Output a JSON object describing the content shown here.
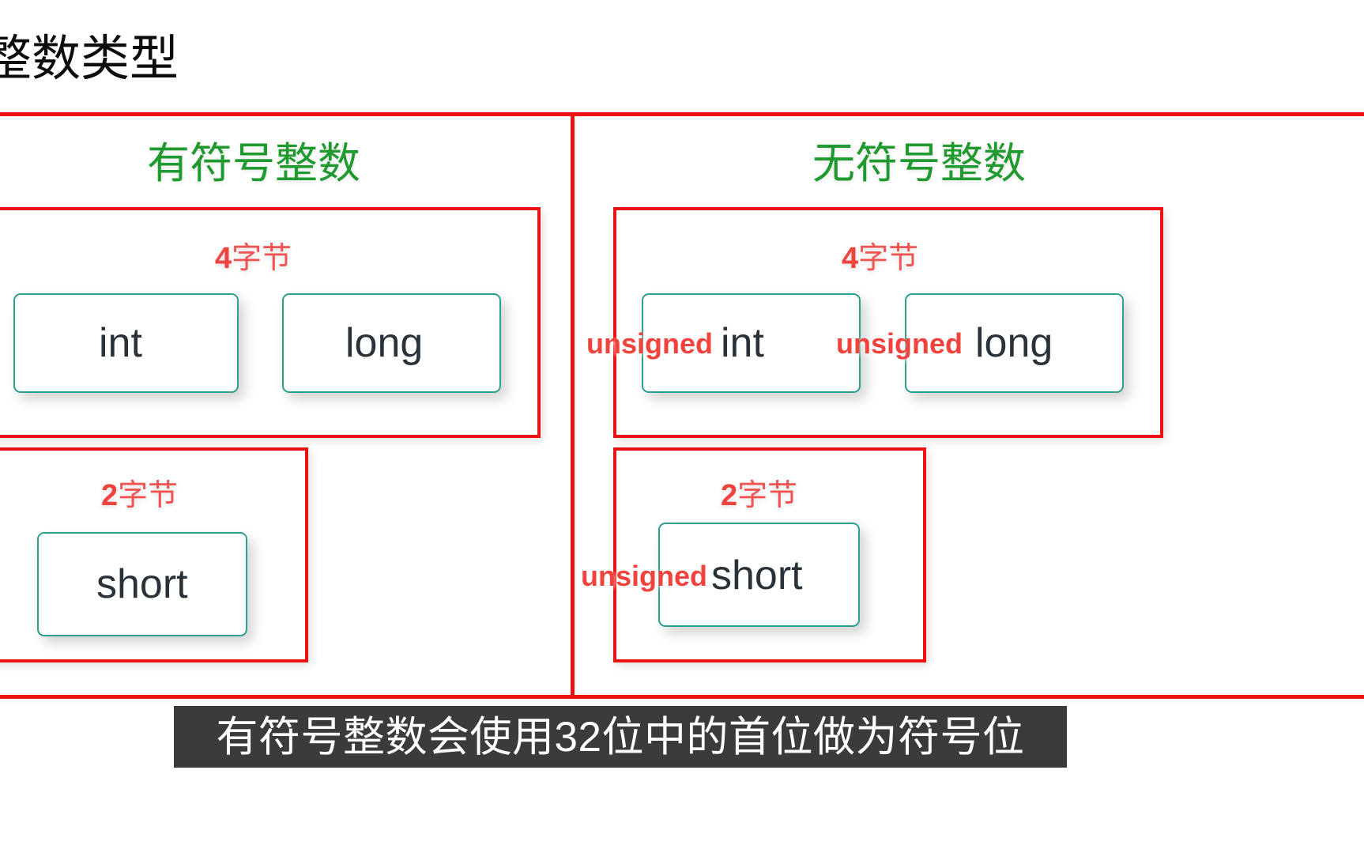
{
  "page": {
    "title": "整数类型",
    "background_color": "#ffffff"
  },
  "colors": {
    "frame_red": "#ee1111",
    "label_red": "#f0433e",
    "heading_green": "#1f9a2e",
    "box_teal": "#2e9e8f",
    "type_text": "#2a3239",
    "subtitle_bg": "#3b3b3b",
    "subtitle_text": "#ffffff"
  },
  "columns": {
    "signed": {
      "heading": "有符号整数",
      "groups": [
        {
          "byte_label_number": "4",
          "byte_label_unit": "字节",
          "types": [
            {
              "prefix": "",
              "name": "int"
            },
            {
              "prefix": "",
              "name": "long"
            }
          ]
        },
        {
          "byte_label_number": "2",
          "byte_label_unit": "字节",
          "types": [
            {
              "prefix": "",
              "name": "short"
            }
          ]
        }
      ]
    },
    "unsigned": {
      "heading": "无符号整数",
      "groups": [
        {
          "byte_label_number": "4",
          "byte_label_unit": "字节",
          "types": [
            {
              "prefix": "unsigned",
              "name": "int"
            },
            {
              "prefix": "unsigned",
              "name": "long"
            }
          ]
        },
        {
          "byte_label_number": "2",
          "byte_label_unit": "字节",
          "types": [
            {
              "prefix": "unsigned",
              "name": "short"
            }
          ]
        }
      ]
    }
  },
  "subtitle": {
    "text": "有符号整数会使用32位中的首位做为符号位"
  }
}
